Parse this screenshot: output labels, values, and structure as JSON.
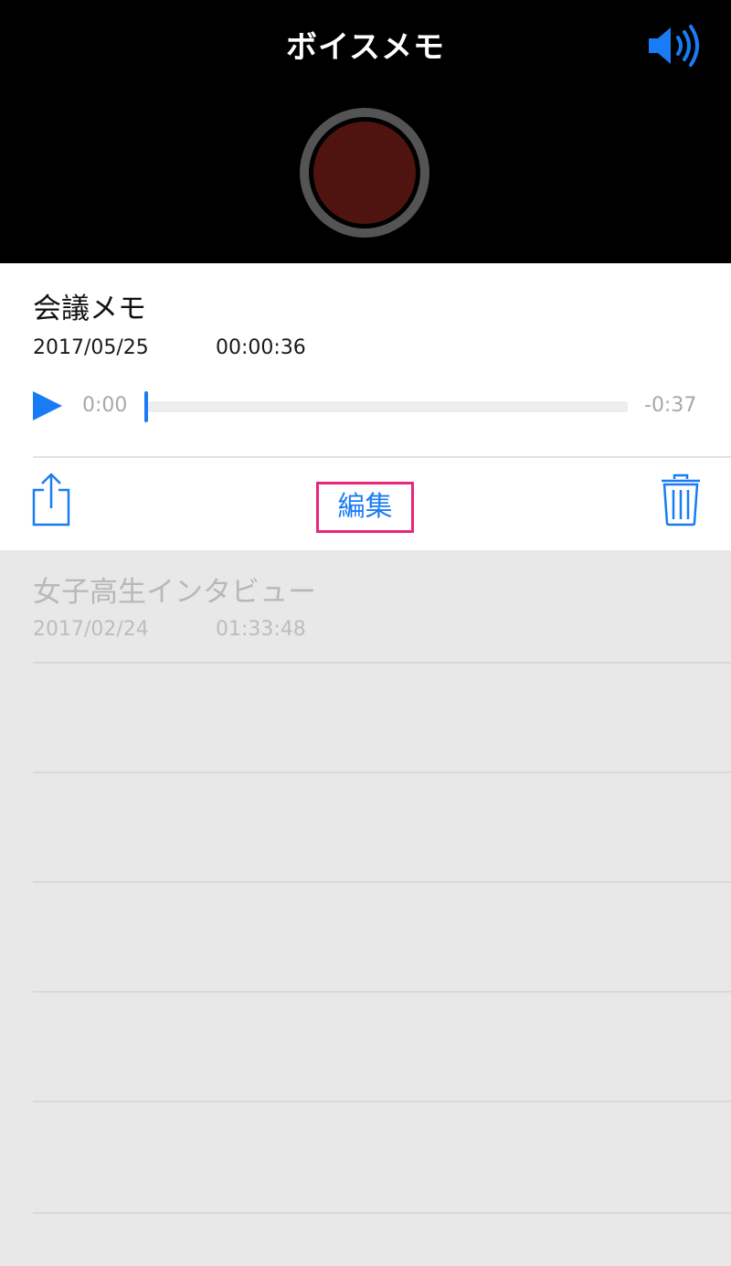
{
  "header": {
    "title": "ボイスメモ",
    "speaker_icon": "speaker-volume-icon",
    "accent_color": "#1a7cf5"
  },
  "current_memo": {
    "title": "会議メモ",
    "date": "2017/05/25",
    "duration": "00:00:36",
    "elapsed": "0:00",
    "remaining": "-0:37",
    "progress": 0,
    "edit_label": "編集",
    "highlight_color": "#e8267c"
  },
  "memo_list": [
    {
      "title": "女子高生インタビュー",
      "date": "2017/02/24",
      "duration": "01:33:48"
    }
  ],
  "icons": {
    "play": "play-icon",
    "share": "share-icon",
    "trash": "trash-icon",
    "record": "record-icon"
  }
}
